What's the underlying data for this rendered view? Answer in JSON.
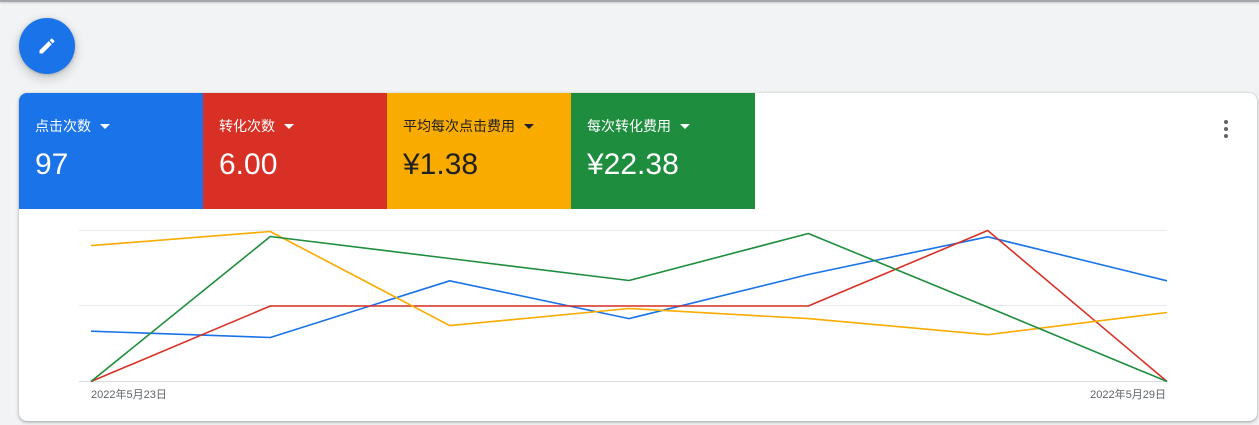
{
  "fab": {
    "icon": "edit-icon"
  },
  "card": {
    "menu_icon": "more-vert-icon"
  },
  "scorecards": [
    {
      "value": "97",
      "text_color": "#ffffff",
      "dropdown_icon": "arrow-drop-down-icon"
    },
    {
      "value": "6.00",
      "text_color": "#ffffff",
      "dropdown_icon": "arrow-drop-down-icon"
    },
    {
      "value": "¥1.38",
      "text_color": "#202124",
      "dropdown_icon": "arrow-drop-down-icon"
    },
    {
      "value": "¥22.38",
      "text_color": "#ffffff",
      "dropdown_icon": "arrow-drop-down-icon"
    }
  ],
  "chart_data": {
    "type": "line",
    "grid": true,
    "x": [
      "2022-05-23",
      "2022-05-24",
      "2022-05-25",
      "2022-05-26",
      "2022-05-27",
      "2022-05-28",
      "2022-05-29"
    ],
    "x_tick_labels": [
      "2022年5月23日",
      "2022年5月29日"
    ],
    "series": [
      {
        "name": "点击次数",
        "color": "#1a73e8",
        "ylim": [
          0,
          24
        ],
        "values": [
          8,
          7,
          16,
          10,
          17,
          23,
          16
        ]
      },
      {
        "name": "转化次数",
        "color": "#d93025",
        "ylim": [
          0,
          2
        ],
        "values": [
          0,
          1,
          1,
          1,
          1,
          2,
          0
        ]
      },
      {
        "name": "平均每次点击费用",
        "color": "#f9ab00",
        "ylim": [
          0,
          3
        ],
        "values": [
          2.7,
          2.98,
          1.11,
          1.45,
          1.25,
          0.93,
          1.37
        ]
      },
      {
        "name": "每次转化费用",
        "color": "#1e8e3e",
        "ylim": [
          0,
          21
        ],
        "values": [
          0,
          20.17,
          17.11,
          14.05,
          20.58,
          10.35,
          0
        ]
      }
    ]
  }
}
